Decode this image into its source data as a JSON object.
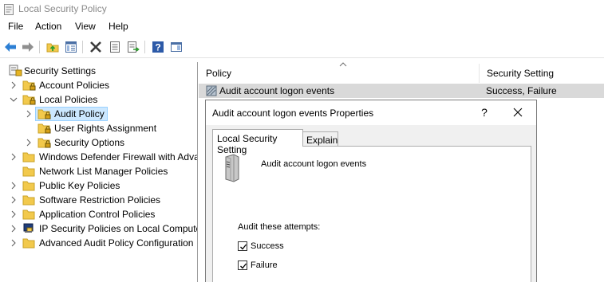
{
  "window": {
    "title": "Local Security Policy"
  },
  "menu": [
    "File",
    "Action",
    "View",
    "Help"
  ],
  "toolbar": {
    "buttons": [
      "back-icon",
      "forward-icon",
      "up-folder-icon",
      "show-tree-icon",
      "delete-icon",
      "properties-icon",
      "export-list-icon",
      "help-icon",
      "console-pane-icon"
    ]
  },
  "tree": {
    "root": "Security Settings",
    "items": [
      {
        "label": "Account Policies",
        "level": 1,
        "expanded": false
      },
      {
        "label": "Local Policies",
        "level": 1,
        "expanded": true
      },
      {
        "label": "Audit Policy",
        "level": 2,
        "expanded": false,
        "selected": true
      },
      {
        "label": "User Rights Assignment",
        "level": 2,
        "expanded": null
      },
      {
        "label": "Security Options",
        "level": 2,
        "expanded": false
      },
      {
        "label": "Windows Defender Firewall with Adva",
        "level": 1,
        "expanded": false
      },
      {
        "label": "Network List Manager Policies",
        "level": 1,
        "expanded": null
      },
      {
        "label": "Public Key Policies",
        "level": 1,
        "expanded": false
      },
      {
        "label": "Software Restriction Policies",
        "level": 1,
        "expanded": false
      },
      {
        "label": "Application Control Policies",
        "level": 1,
        "expanded": false
      },
      {
        "label": "IP Security Policies on Local Compute",
        "level": 1,
        "expanded": false
      },
      {
        "label": "Advanced Audit Policy Configuration",
        "level": 1,
        "expanded": false
      }
    ]
  },
  "list": {
    "columns": [
      "Policy",
      "Security Setting"
    ],
    "rows": [
      {
        "policy": "Audit account logon events",
        "setting": "Success, Failure"
      }
    ]
  },
  "dialog": {
    "title": "Audit account logon events Properties",
    "help": "?",
    "tabs": [
      "Local Security Setting",
      "Explain"
    ],
    "policy_name": "Audit account logon events",
    "audit_label": "Audit these attempts:",
    "options": [
      {
        "label": "Success",
        "checked": true
      },
      {
        "label": "Failure",
        "checked": true
      }
    ]
  },
  "colors": {
    "selection": "#cce8ff",
    "selection_border": "#99d1ff",
    "row_highlight": "#d9d9d9",
    "folder": "#f2c94c"
  }
}
